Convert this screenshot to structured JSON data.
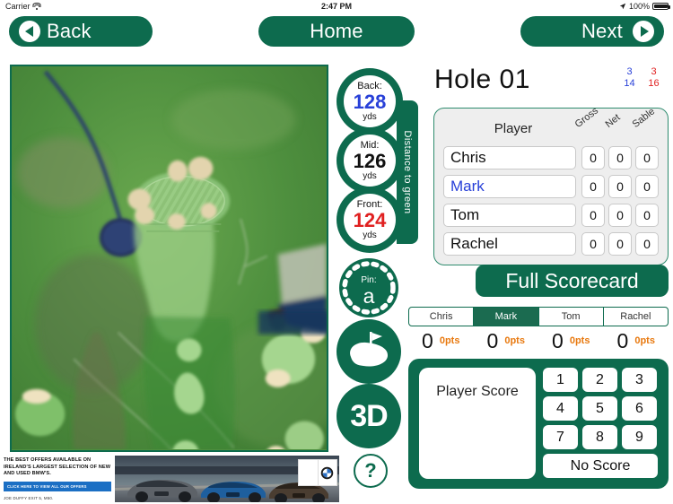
{
  "statusbar": {
    "carrier": "Carrier",
    "time": "2:47 PM",
    "battery": "100%"
  },
  "topnav": {
    "back": "Back",
    "home": "Home",
    "next": "Next"
  },
  "distances": {
    "tab_label": "Distance to green",
    "nodes": [
      {
        "label": "Back:",
        "value": "128",
        "unit": "yds",
        "color": "#2840d8"
      },
      {
        "label": "Mid:",
        "value": "126",
        "unit": "yds",
        "color": "#111111"
      },
      {
        "label": "Front:",
        "value": "124",
        "unit": "yds",
        "color": "#e02020"
      }
    ]
  },
  "pin": {
    "label": "Pin:",
    "value": "a"
  },
  "view_buttons": {
    "green_icon": "green-flag-icon",
    "three_d": "3D",
    "help": "?"
  },
  "hole": {
    "title": "Hole 01",
    "numbers": {
      "par_blue": "3",
      "par_red": "3",
      "si_blue": "14",
      "si_red": "16"
    }
  },
  "scorecard": {
    "header": {
      "player": "Player",
      "gross": "Gross",
      "net": "Net",
      "stable": "Sable"
    },
    "rows": [
      {
        "name": "Chris",
        "gross": "0",
        "net": "0",
        "stable": "0",
        "selected": false
      },
      {
        "name": "Mark",
        "gross": "0",
        "net": "0",
        "stable": "0",
        "selected": true
      },
      {
        "name": "Tom",
        "gross": "0",
        "net": "0",
        "stable": "0",
        "selected": false
      },
      {
        "name": "Rachel",
        "gross": "0",
        "net": "0",
        "stable": "0",
        "selected": false
      }
    ],
    "full_scorecard_label": "Full Scorecard"
  },
  "player_tabs": {
    "items": [
      "Chris",
      "Mark",
      "Tom",
      "Rachel"
    ],
    "active_index": 1,
    "totals": [
      {
        "score": "0",
        "points": "0pts"
      },
      {
        "score": "0",
        "points": "0pts"
      },
      {
        "score": "0",
        "points": "0pts"
      },
      {
        "score": "0",
        "points": "0pts"
      }
    ]
  },
  "keypad": {
    "player_score_label": "Player Score",
    "keys": [
      "1",
      "2",
      "3",
      "4",
      "5",
      "6",
      "7",
      "8",
      "9"
    ],
    "no_score_label": "No Score"
  },
  "ad": {
    "headline": "THE BEST OFFERS AVAILABLE ON IRELAND'S LARGEST SELECTION OF NEW AND USED BMW'S.",
    "cta": "CLICK HERE TO VIEW ALL OUR OFFERS",
    "footer": "JOE DUFFY EXIT 5, M50."
  },
  "colors": {
    "brand_green": "#0d6b4e",
    "accent_orange": "#e8790f",
    "blue": "#2840d8",
    "red": "#e02020"
  }
}
